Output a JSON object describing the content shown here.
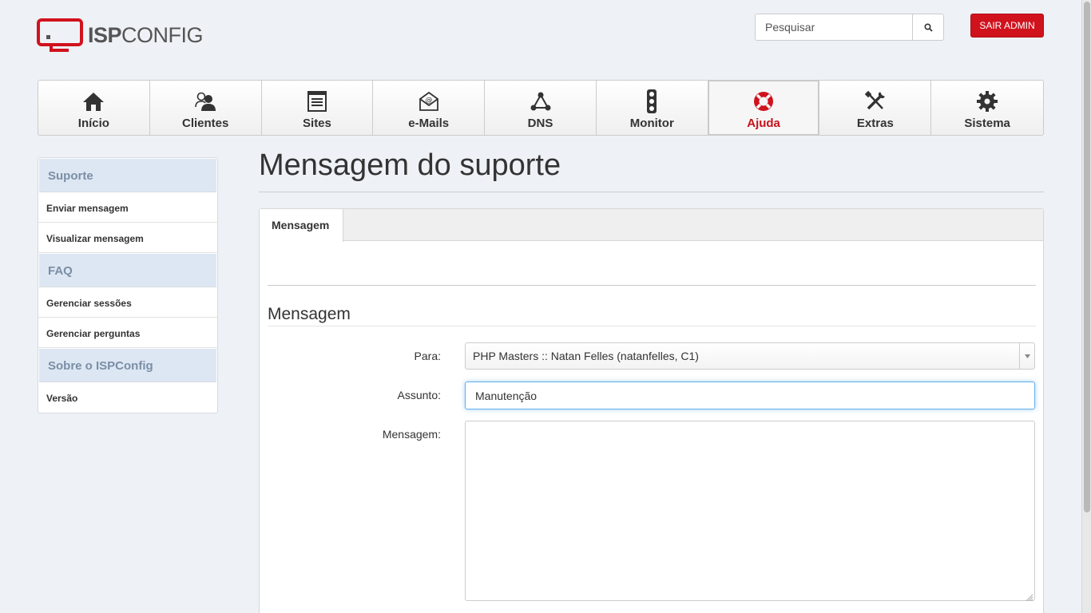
{
  "header": {
    "logo_text_bold": "ISP",
    "logo_text_light": "CONFIG",
    "search_placeholder": "Pesquisar",
    "logout_label": "SAIR ADMIN"
  },
  "nav": {
    "tabs": [
      {
        "label": "Início",
        "icon": "home-icon"
      },
      {
        "label": "Clientes",
        "icon": "users-icon"
      },
      {
        "label": "Sites",
        "icon": "sites-icon"
      },
      {
        "label": "e-Mails",
        "icon": "email-icon"
      },
      {
        "label": "DNS",
        "icon": "dns-icon"
      },
      {
        "label": "Monitor",
        "icon": "traffic-light-icon"
      },
      {
        "label": "Ajuda",
        "icon": "lifebuoy-icon",
        "active": true
      },
      {
        "label": "Extras",
        "icon": "tools-icon"
      },
      {
        "label": "Sistema",
        "icon": "gear-icon"
      }
    ]
  },
  "sidebar": {
    "sections": [
      {
        "title": "Suporte",
        "items": [
          "Enviar mensagem",
          "Visualizar mensagem"
        ]
      },
      {
        "title": "FAQ",
        "items": [
          "Gerenciar sessões",
          "Gerenciar perguntas"
        ]
      },
      {
        "title": "Sobre o ISPConfig",
        "items": [
          "Versão"
        ]
      }
    ]
  },
  "main": {
    "page_title": "Mensagem do suporte",
    "tab_label": "Mensagem",
    "section_title": "Mensagem",
    "form": {
      "to_label": "Para:",
      "to_value": "PHP Masters :: Natan Felles (natanfelles, C1)",
      "subject_label": "Assunto:",
      "subject_value": "Manutenção",
      "message_label": "Mensagem:"
    }
  },
  "colors": {
    "brand_red": "#d0121d",
    "active_tab_text": "#c8121b",
    "sidebar_header_bg": "#dde7f3"
  }
}
